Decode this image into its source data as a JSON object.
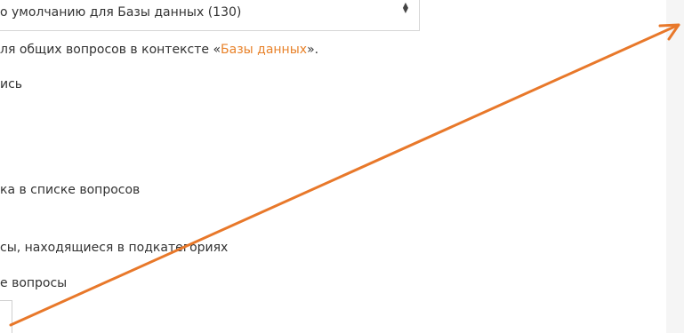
{
  "context_select": {
    "value": "о умолчанию для Базы данных (130)"
  },
  "help": {
    "before": "ля общих вопросов в контексте «",
    "link": "Базы данных",
    "after": "»."
  },
  "options": {
    "line1": "ись",
    "line2": "ка в списке вопросов",
    "line3": "сы, находящиеся в подкатегориях",
    "line4": "е вопросы"
  },
  "colors": {
    "accent": "#e8822a",
    "annotation_arrow": "#e8782a"
  },
  "icons": {
    "select_caret": "up-down-caret-icon",
    "annotation": "arrow-annotation"
  }
}
